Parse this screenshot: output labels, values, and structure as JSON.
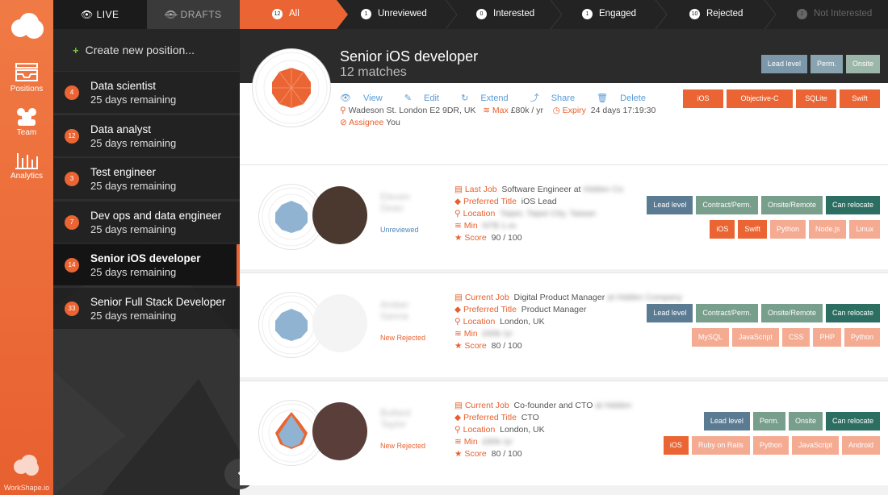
{
  "rail": {
    "items": [
      {
        "label": "Positions",
        "icon": "inbox-icon"
      },
      {
        "label": "Team",
        "icon": "team-icon"
      },
      {
        "label": "Analytics",
        "icon": "analytics-icon"
      }
    ],
    "brand": "WorkShape.io"
  },
  "sidebar": {
    "tabs": [
      {
        "label": "LIVE",
        "icon": "eye-icon"
      },
      {
        "label": "DRAFTS",
        "icon": "eye-slash-icon"
      }
    ],
    "create_label": "Create new position...",
    "positions": [
      {
        "count": "4",
        "title": "Data scientist",
        "remaining": "25 days remaining"
      },
      {
        "count": "12",
        "title": "Data analyst",
        "remaining": "25 days remaining"
      },
      {
        "count": "3",
        "title": "Test engineer",
        "remaining": "25 days remaining"
      },
      {
        "count": "7",
        "title": "Dev ops and data engineer",
        "remaining": "25 days remaining"
      },
      {
        "count": "14",
        "title": "Senior iOS developer",
        "remaining": "25 days remaining"
      },
      {
        "count": "33",
        "title": "Senior Full Stack Developer",
        "remaining": "25 days remaining"
      }
    ]
  },
  "filters": [
    {
      "count": "12",
      "label": "All"
    },
    {
      "count": "1",
      "label": "Unreviewed"
    },
    {
      "count": "0",
      "label": "Interested"
    },
    {
      "count": "1",
      "label": "Engaged"
    },
    {
      "count": "10",
      "label": "Rejected"
    },
    {
      "count": "2",
      "label": "Not Interested"
    }
  ],
  "position": {
    "title": "Senior iOS developer",
    "matches": "12 matches",
    "actions": [
      "View",
      "Edit",
      "Extend",
      "Share",
      "Delete"
    ],
    "address": "Wadeson St. London E2 9DR, UK",
    "max_label": "Max",
    "max_value": "£80k / yr",
    "expiry_label": "Expiry",
    "expiry_value": "24 days 17:19:30",
    "assignee_label": "Assignee",
    "assignee_value": "You",
    "top_tags": [
      "Lead level",
      "Perm.",
      "Onsite"
    ],
    "skill_tags": [
      "iOS",
      "Objective-C",
      "SQLite",
      "Swift"
    ]
  },
  "candidates": [
    {
      "name": "Eleven Dean",
      "status": "Unreviewed",
      "status2": "",
      "job_label": "Last Job",
      "job_value": "Software Engineer at",
      "job_blur": "Hidden Co",
      "title_label": "Preferred Title",
      "title_value": "iOS Lead",
      "location_label": "Location",
      "location_value": "Taipei, Taipei City, Taiwan",
      "min_label": "Min",
      "min_value": "NT$ 1.xx",
      "score_label": "Score",
      "score_value": "90 / 100",
      "tags": [
        "Lead level",
        "Contract/Perm.",
        "Onsite/Remote",
        "Can relocate"
      ],
      "skills": [
        "iOS",
        "Swift",
        "Python",
        "Node.js",
        "Linux"
      ]
    },
    {
      "name": "Amber Sanna",
      "status": "New",
      "status2": "Rejected",
      "job_label": "Current Job",
      "job_value": "Digital Product Manager",
      "job_blur": "at Hidden Company",
      "title_label": "Preferred Title",
      "title_value": "Product Manager",
      "location_label": "Location",
      "location_value": "London, UK",
      "min_label": "Min",
      "min_value": "£60k /yr",
      "score_label": "Score",
      "score_value": "80 / 100",
      "tags": [
        "Lead level",
        "Contract/Perm.",
        "Onsite/Remote",
        "Can relocate"
      ],
      "skills": [
        "MySQL",
        "JavaScript",
        "CSS",
        "PHP",
        "Python"
      ]
    },
    {
      "name": "Bullard Taylor",
      "status": "New",
      "status2": "Rejected",
      "job_label": "Current Job",
      "job_value": "Co-founder and CTO",
      "job_blur": "at Hidden",
      "title_label": "Preferred Title",
      "title_value": "CTO",
      "location_label": "Location",
      "location_value": "London, UK",
      "min_label": "Min",
      "min_value": "£80k /yr",
      "score_label": "Score",
      "score_value": "80 / 100",
      "tags": [
        "Lead level",
        "Perm.",
        "Onsite",
        "Can relocate"
      ],
      "skills": [
        "iOS",
        "Ruby on Rails",
        "Python",
        "JavaScript",
        "Android"
      ]
    }
  ]
}
